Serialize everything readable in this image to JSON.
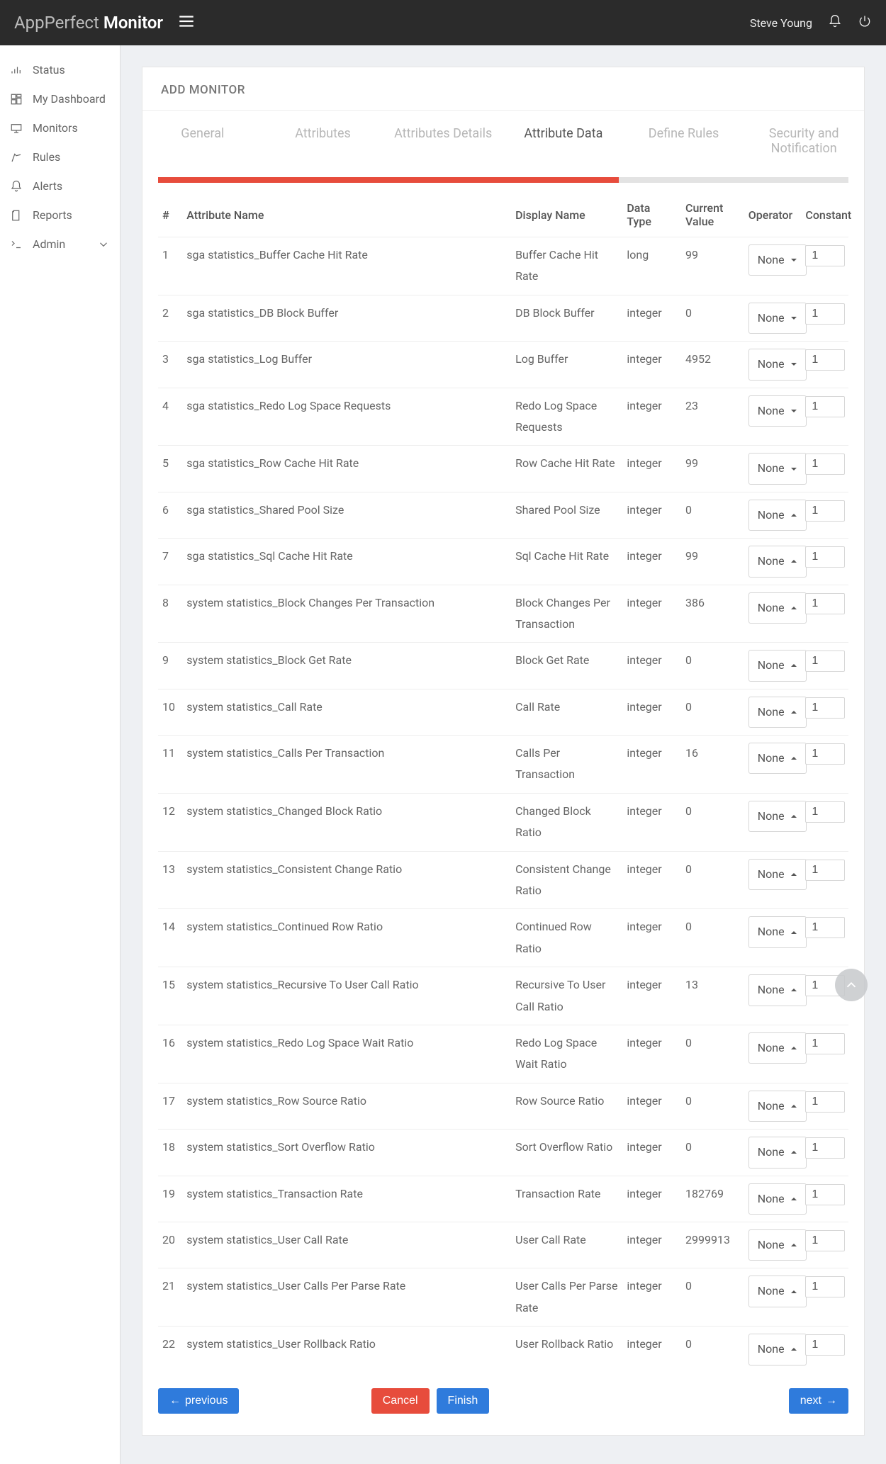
{
  "header": {
    "brand_light": "AppPerfect",
    "brand_bold": "Monitor",
    "user": "Steve Young"
  },
  "sidebar": {
    "items": [
      {
        "label": "Status",
        "icon": "status-icon"
      },
      {
        "label": "My Dashboard",
        "icon": "dashboard-icon"
      },
      {
        "label": "Monitors",
        "icon": "monitors-icon"
      },
      {
        "label": "Rules",
        "icon": "rules-icon"
      },
      {
        "label": "Alerts",
        "icon": "alerts-icon"
      },
      {
        "label": "Reports",
        "icon": "reports-icon"
      },
      {
        "label": "Admin",
        "icon": "admin-icon",
        "chevron": true
      }
    ]
  },
  "panel": {
    "title": "ADD MONITOR",
    "tabs": [
      "General",
      "Attributes",
      "Attributes Details",
      "Attribute Data",
      "Define Rules",
      "Security and Notification"
    ],
    "active_tab_index": 3,
    "progress_percent": 66.7,
    "columns": [
      "#",
      "Attribute Name",
      "Display Name",
      "Data Type",
      "Current Value",
      "Operator",
      "Constant"
    ],
    "operator_default": "None",
    "constant_default": "1",
    "rows": [
      {
        "idx": "1",
        "name": "sga statistics_Buffer Cache Hit Rate",
        "display": "Buffer Cache Hit Rate",
        "type": "long",
        "value": "99",
        "caret": "down"
      },
      {
        "idx": "2",
        "name": "sga statistics_DB Block Buffer",
        "display": "DB Block Buffer",
        "type": "integer",
        "value": "0",
        "caret": "down"
      },
      {
        "idx": "3",
        "name": "sga statistics_Log Buffer",
        "display": "Log Buffer",
        "type": "integer",
        "value": "4952",
        "caret": "down"
      },
      {
        "idx": "4",
        "name": "sga statistics_Redo Log Space Requests",
        "display": "Redo Log Space Requests",
        "type": "integer",
        "value": "23",
        "caret": "down"
      },
      {
        "idx": "5",
        "name": "sga statistics_Row Cache Hit Rate",
        "display": "Row Cache Hit Rate",
        "type": "integer",
        "value": "99",
        "caret": "down"
      },
      {
        "idx": "6",
        "name": "sga statistics_Shared Pool Size",
        "display": "Shared Pool Size",
        "type": "integer",
        "value": "0",
        "caret": "up"
      },
      {
        "idx": "7",
        "name": "sga statistics_Sql Cache Hit Rate",
        "display": "Sql Cache Hit Rate",
        "type": "integer",
        "value": "99",
        "caret": "up"
      },
      {
        "idx": "8",
        "name": "system statistics_Block Changes Per Transaction",
        "display": "Block Changes Per Transaction",
        "type": "integer",
        "value": "386",
        "caret": "up"
      },
      {
        "idx": "9",
        "name": "system statistics_Block Get Rate",
        "display": "Block Get Rate",
        "type": "integer",
        "value": "0",
        "caret": "up"
      },
      {
        "idx": "10",
        "name": "system statistics_Call Rate",
        "display": "Call Rate",
        "type": "integer",
        "value": "0",
        "caret": "up"
      },
      {
        "idx": "11",
        "name": "system statistics_Calls Per Transaction",
        "display": "Calls Per Transaction",
        "type": "integer",
        "value": "16",
        "caret": "up"
      },
      {
        "idx": "12",
        "name": "system statistics_Changed Block Ratio",
        "display": "Changed Block Ratio",
        "type": "integer",
        "value": "0",
        "caret": "up"
      },
      {
        "idx": "13",
        "name": "system statistics_Consistent Change Ratio",
        "display": "Consistent Change Ratio",
        "type": "integer",
        "value": "0",
        "caret": "up"
      },
      {
        "idx": "14",
        "name": "system statistics_Continued Row Ratio",
        "display": "Continued Row Ratio",
        "type": "integer",
        "value": "0",
        "caret": "up"
      },
      {
        "idx": "15",
        "name": "system statistics_Recursive To User Call Ratio",
        "display": "Recursive To User Call Ratio",
        "type": "integer",
        "value": "13",
        "caret": "up"
      },
      {
        "idx": "16",
        "name": "system statistics_Redo Log Space Wait Ratio",
        "display": "Redo Log Space Wait Ratio",
        "type": "integer",
        "value": "0",
        "caret": "up"
      },
      {
        "idx": "17",
        "name": "system statistics_Row Source Ratio",
        "display": "Row Source Ratio",
        "type": "integer",
        "value": "0",
        "caret": "up"
      },
      {
        "idx": "18",
        "name": "system statistics_Sort Overflow Ratio",
        "display": "Sort Overflow Ratio",
        "type": "integer",
        "value": "0",
        "caret": "up"
      },
      {
        "idx": "19",
        "name": "system statistics_Transaction Rate",
        "display": "Transaction Rate",
        "type": "integer",
        "value": "182769",
        "caret": "up"
      },
      {
        "idx": "20",
        "name": "system statistics_User Call Rate",
        "display": "User Call Rate",
        "type": "integer",
        "value": "2999913",
        "caret": "up"
      },
      {
        "idx": "21",
        "name": "system statistics_User Calls Per Parse Rate",
        "display": "User Calls Per Parse Rate",
        "type": "integer",
        "value": "0",
        "caret": "up"
      },
      {
        "idx": "22",
        "name": "system statistics_User Rollback Ratio",
        "display": "User Rollback Ratio",
        "type": "integer",
        "value": "0",
        "caret": "up"
      }
    ],
    "buttons": {
      "previous": "previous",
      "cancel": "Cancel",
      "finish": "Finish",
      "next": "next"
    }
  }
}
